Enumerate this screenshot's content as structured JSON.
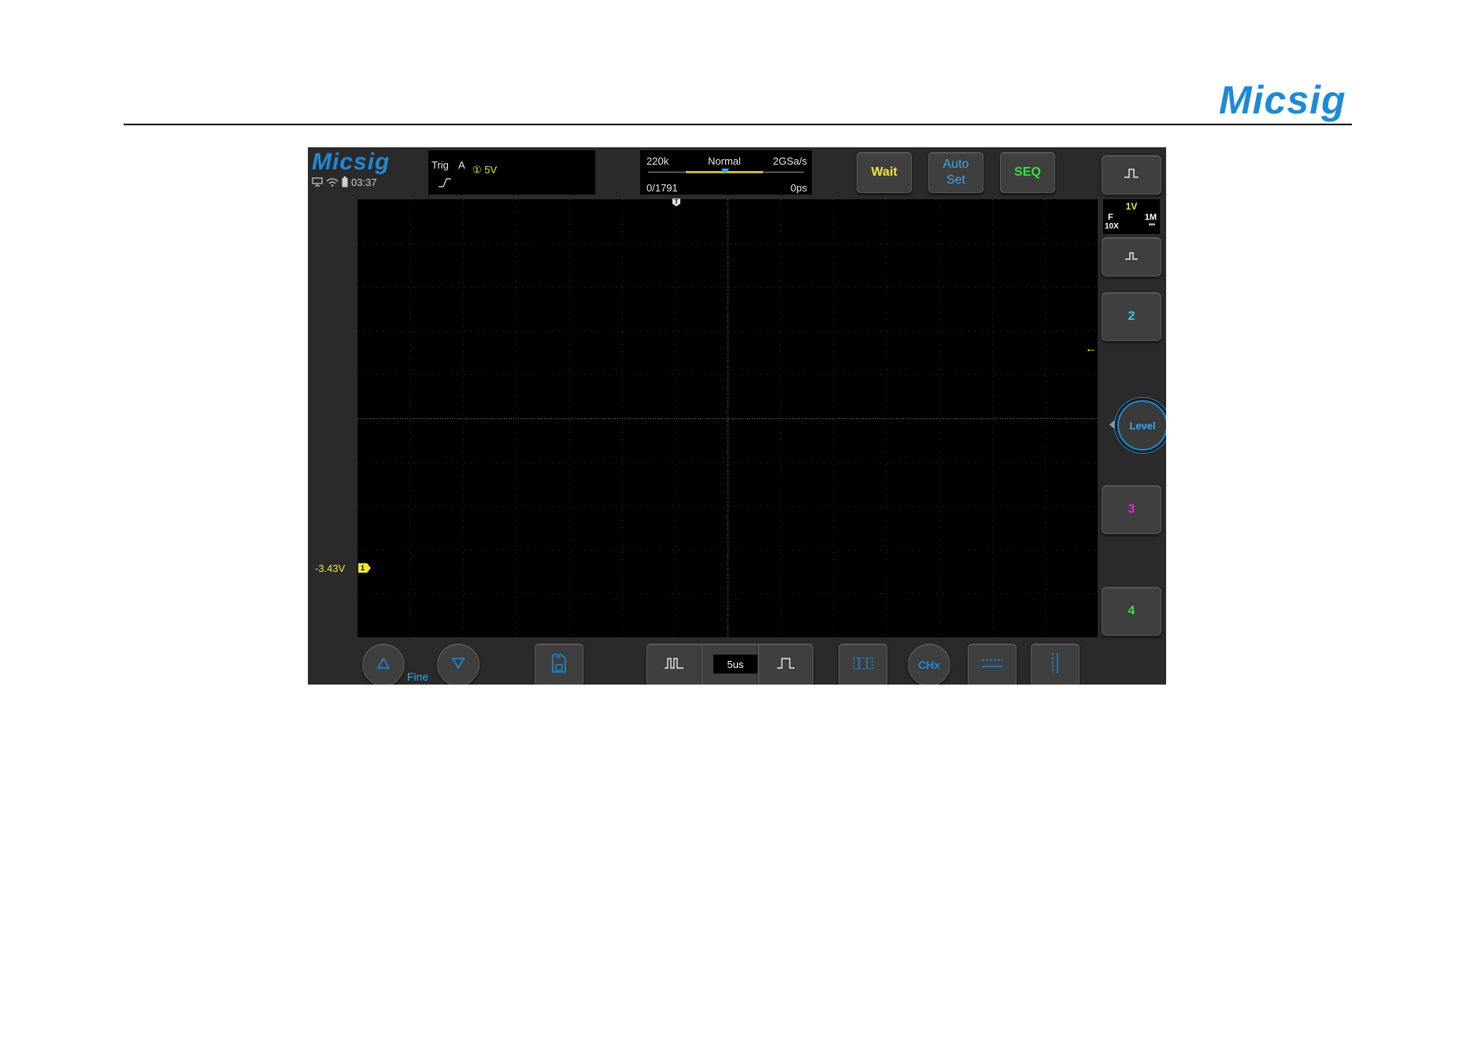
{
  "page": {
    "brand": "Micsig"
  },
  "scope": {
    "brand": "Micsig",
    "status": {
      "time": "03:37",
      "icons": [
        "monitor-icon",
        "wifi-icon",
        "battery-icon"
      ]
    },
    "trigger": {
      "label": "Trig",
      "source": "A",
      "channel_level": "① 5V",
      "edge_icon": "rising-edge-icon"
    },
    "acquisition": {
      "memory_depth": "220k",
      "mode": "Normal",
      "sample_rate": "2GSa/s",
      "frame_counter": "0/1791",
      "horizontal_position": "0ps"
    },
    "toolbar": {
      "wait_label": "Wait",
      "autoset_label": "Auto\nSet",
      "seq_label": "SEQ"
    },
    "grid": {
      "trigger_time_marker": "T",
      "ch1_offset": "-3.43V",
      "ch1_marker": "1"
    },
    "channels": {
      "ch1": {
        "volts_per_div": "1V",
        "coupling": "F",
        "impedance": "1M",
        "probe": "10X",
        "dc_symbol": "⎓",
        "color": "#f0e63a"
      },
      "ch2": {
        "label": "2",
        "color": "#39c9e8"
      },
      "ch3": {
        "label": "3",
        "color": "#e02ad8"
      },
      "ch4": {
        "label": "4",
        "color": "#3be03b"
      }
    },
    "level_knob": {
      "label": "Level"
    },
    "bottom": {
      "fine_label": "Fine",
      "timebase": "5us",
      "cursor_icon": "cursor-icon",
      "chx_label": "CHx"
    },
    "colors": {
      "background": "#2a2a2a",
      "screen": "#000000",
      "accent": "#1e8ad6",
      "ch1": "#f0e63a"
    }
  }
}
